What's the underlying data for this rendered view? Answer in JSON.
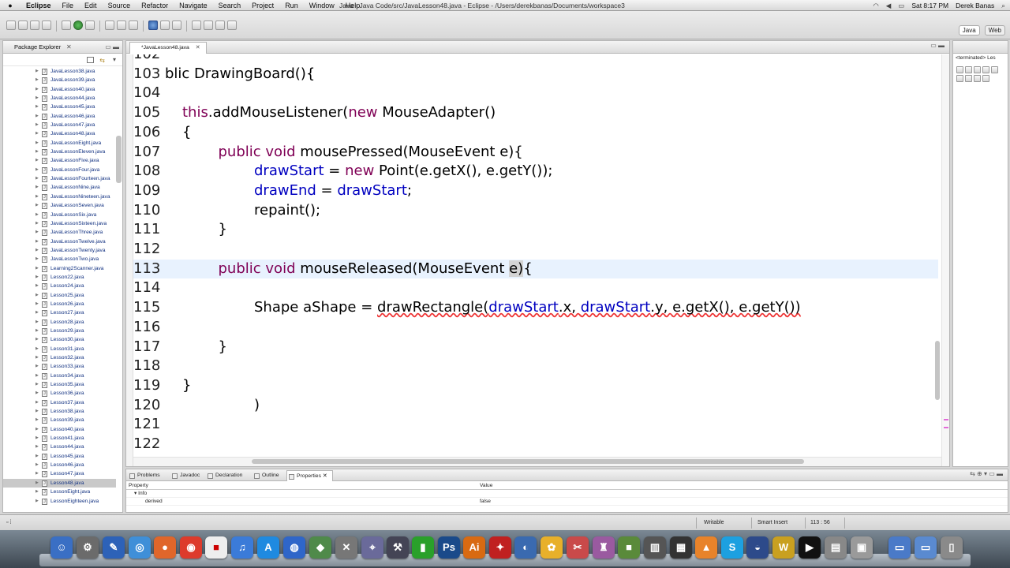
{
  "menubar": {
    "app": "Eclipse",
    "items": [
      "File",
      "Edit",
      "Source",
      "Refactor",
      "Navigate",
      "Search",
      "Project",
      "Run",
      "Window",
      "Help"
    ],
    "window_title": "Java - Java Code/src/JavaLesson48.java - Eclipse - /Users/derekbanas/Documents/workspace3",
    "clock": "Sat 8:17 PM",
    "user": "Derek Banas"
  },
  "perspectives": [
    "Java",
    "Web"
  ],
  "package_explorer": {
    "title": "Package Explorer",
    "files": [
      "JavaLesson38.java",
      "JavaLesson39.java",
      "JavaLesson40.java",
      "JavaLesson44.java",
      "JavaLesson45.java",
      "JavaLesson46.java",
      "JavaLesson47.java",
      "JavaLesson48.java",
      "JavaLessonEight.java",
      "JavaLessonEleven.java",
      "JavaLessonFive.java",
      "JavaLessonFour.java",
      "JavaLessonFourteen.java",
      "JavaLessonNine.java",
      "JavaLessonNineteen.java",
      "JavaLessonSeven.java",
      "JavaLessonSix.java",
      "JavaLessonSixteen.java",
      "JavaLessonThree.java",
      "JavaLessonTwelve.java",
      "JavaLessonTwenty.java",
      "JavaLessonTwo.java",
      "Learning2Scanner.java",
      "Lesson22.java",
      "Lesson24.java",
      "Lesson25.java",
      "Lesson26.java",
      "Lesson27.java",
      "Lesson28.java",
      "Lesson29.java",
      "Lesson30.java",
      "Lesson31.java",
      "Lesson32.java",
      "Lesson33.java",
      "Lesson34.java",
      "Lesson35.java",
      "Lesson36.java",
      "Lesson37.java",
      "Lesson38.java",
      "Lesson39.java",
      "Lesson40.java",
      "Lesson41.java",
      "Lesson44.java",
      "Lesson45.java",
      "Lesson46.java",
      "Lesson47.java",
      "Lesson48.java",
      "LessonEight.java",
      "LessonEighteen.java"
    ],
    "selected_file": "Lesson48.java"
  },
  "editor": {
    "tab_label": "*JavaLesson48.java",
    "current_line": "113",
    "lines": [
      {
        "num": "102",
        "text": ""
      },
      {
        "num": "103",
        "text": "blic DrawingBoard(){"
      },
      {
        "num": "104",
        "text": ""
      },
      {
        "num": "105",
        "text": "this.addMouseListener(new MouseAdapter()"
      },
      {
        "num": "106",
        "text": "{"
      },
      {
        "num": "107",
        "text": "public void mousePressed(MouseEvent e){"
      },
      {
        "num": "108",
        "text": "drawStart = new Point(e.getX(), e.getY());"
      },
      {
        "num": "109",
        "text": "drawEnd = drawStart;"
      },
      {
        "num": "110",
        "text": "repaint();"
      },
      {
        "num": "111",
        "text": "}"
      },
      {
        "num": "112",
        "text": ""
      },
      {
        "num": "113",
        "text": "public void mouseReleased(MouseEvent e){"
      },
      {
        "num": "114",
        "text": ""
      },
      {
        "num": "115",
        "text": "Shape aShape = drawRectangle(drawStart.x, drawStart.y, e.getX(), e.getY())"
      },
      {
        "num": "116",
        "text": ""
      },
      {
        "num": "117",
        "text": "}"
      },
      {
        "num": "118",
        "text": ""
      },
      {
        "num": "119",
        "text": "}"
      },
      {
        "num": "120",
        "text": ")"
      },
      {
        "num": "121",
        "text": ""
      },
      {
        "num": "122",
        "text": ""
      },
      {
        "num": "123",
        "text": ""
      }
    ]
  },
  "right_panel": {
    "label": "<terminated> Les"
  },
  "bottom_panel": {
    "tabs": [
      "Problems",
      "Javadoc",
      "Declaration",
      "Outline",
      "Properties"
    ],
    "active_tab": "Properties",
    "columns": [
      "Property",
      "Value"
    ],
    "rows": [
      {
        "property": "Info",
        "value": ""
      },
      {
        "property": "derived",
        "value": "false"
      }
    ]
  },
  "statusbar": {
    "writable": "Writable",
    "insert_mode": "Smart Insert",
    "position": "113 : 56"
  },
  "colors": {
    "keyword": "#7f0055",
    "field": "#0000c0",
    "current_line_bg": "#e8f2fe"
  }
}
